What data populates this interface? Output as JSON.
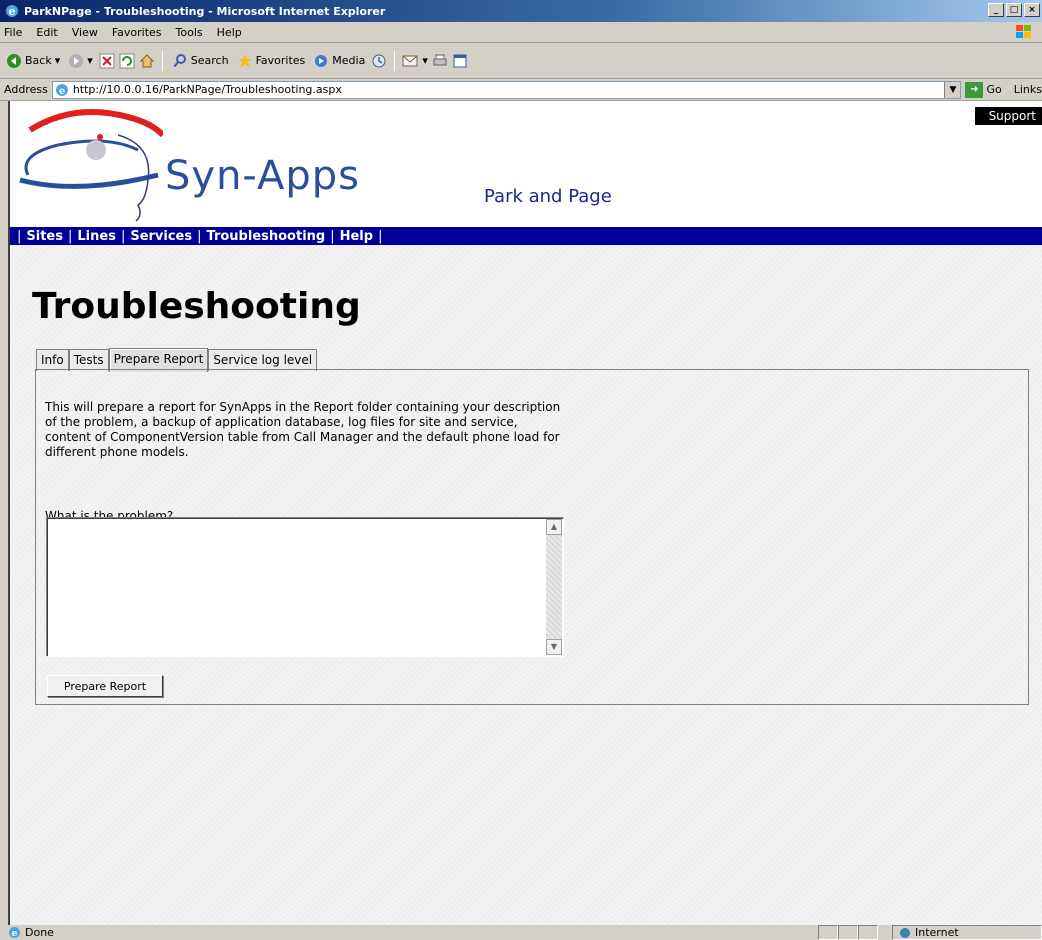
{
  "window": {
    "title": "ParkNPage - Troubleshooting - Microsoft Internet Explorer",
    "controls": [
      "_",
      "□",
      "×"
    ]
  },
  "menu": [
    "File",
    "Edit",
    "View",
    "Favorites",
    "Tools",
    "Help"
  ],
  "toolbar": {
    "back": "Back",
    "search": "Search",
    "favorites": "Favorites",
    "media": "Media"
  },
  "address": {
    "label": "Address",
    "url": "http://10.0.0.16/ParkNPage/Troubleshooting.aspx",
    "go": "Go",
    "links": "Links"
  },
  "site": {
    "brand": "Syn-Apps",
    "subtitle": "Park and Page",
    "support": "Support",
    "nav": [
      "Sites",
      "Lines",
      "Services",
      "Troubleshooting",
      "Help"
    ]
  },
  "page": {
    "title": "Troubleshooting",
    "tabs": [
      "Info",
      "Tests",
      "Prepare Report",
      "Service log level"
    ],
    "active_tab": "Prepare Report",
    "description": "This will prepare a report for SynApps in the Report folder containing your description of the problem, a backup of application database, log files for site and service, content of ComponentVersion table from Call Manager and the default phone load for different phone models.",
    "question_label": "What is the problem?",
    "question_value": "",
    "button_label": "Prepare Report"
  },
  "status": {
    "text": "Done",
    "zone": "Internet"
  }
}
